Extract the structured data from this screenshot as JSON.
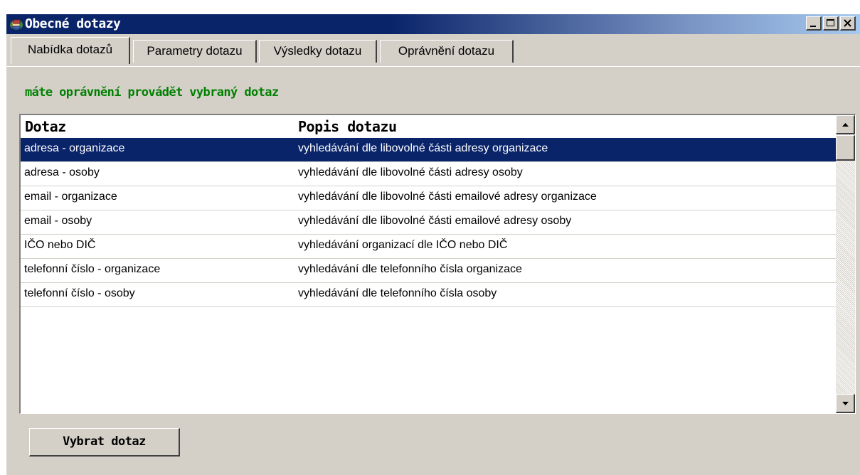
{
  "window": {
    "title": "Obecné dotazy",
    "title_icon": "books-icon"
  },
  "tabs": [
    {
      "label": "Nabídka dotazů",
      "active": true
    },
    {
      "label": "Parametry dotazu",
      "active": false
    },
    {
      "label": "Výsledky dotazu",
      "active": false
    },
    {
      "label": "Oprávnění dotazu",
      "active": false
    }
  ],
  "permission_message": "máte oprávnění provádět vybraný dotaz",
  "table": {
    "columns": [
      "Dotaz",
      "Popis dotazu"
    ],
    "rows": [
      {
        "dotaz": "adresa - organizace",
        "popis": "vyhledávání dle libovolné části adresy organizace",
        "selected": true
      },
      {
        "dotaz": "adresa - osoby",
        "popis": "vyhledávání dle libovolné části adresy osoby",
        "selected": false
      },
      {
        "dotaz": "email - organizace",
        "popis": "vyhledávání dle libovolné části emailové adresy organizace",
        "selected": false
      },
      {
        "dotaz": "email - osoby",
        "popis": "vyhledávání dle libovolné části emailové adresy osoby",
        "selected": false
      },
      {
        "dotaz": "IČO nebo DIČ",
        "popis": "vyhledávání organizací dle IČO nebo DIČ",
        "selected": false
      },
      {
        "dotaz": "telefonní číslo - organizace",
        "popis": "vyhledávání dle telefonního čísla organizace",
        "selected": false
      },
      {
        "dotaz": "telefonní číslo - osoby",
        "popis": "vyhledávání dle telefonního čísla osoby",
        "selected": false
      }
    ]
  },
  "select_button_label": "Vybrat dotaz",
  "colors": {
    "title_bar": "#0a246a",
    "selection": "#0a246a",
    "permission_text": "#008000",
    "face": "#d4d0c8"
  }
}
